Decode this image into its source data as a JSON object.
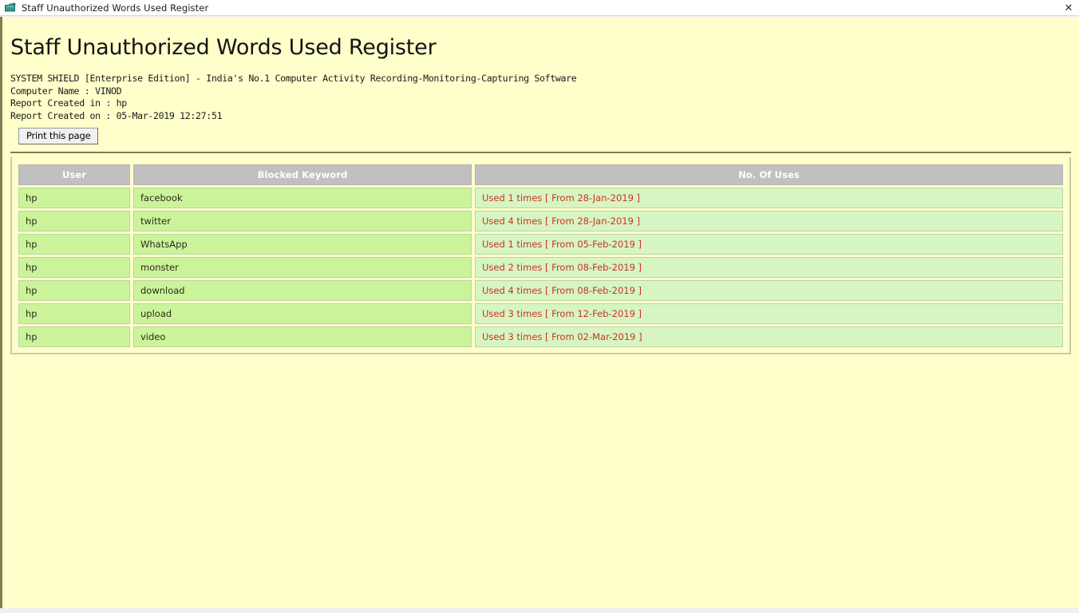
{
  "window": {
    "title": "Staff Unauthorized Words Used Register",
    "icon": "browser-window-icon",
    "close_label": "✕"
  },
  "report": {
    "heading": "Staff Unauthorized Words Used Register",
    "info_lines": [
      "SYSTEM SHIELD [Enterprise Edition] - India's No.1 Computer Activity Recording-Monitoring-Capturing Software",
      "Computer Name : VINOD",
      "Report Created in : hp",
      "Report Created on : 05-Mar-2019 12:27:51"
    ],
    "print_button_label": "Print this page"
  },
  "table": {
    "columns": [
      "User",
      "Blocked Keyword",
      "No. Of Uses"
    ],
    "rows": [
      {
        "user": "hp",
        "keyword": "facebook",
        "uses": "Used 1 times [ From 28-Jan-2019 ]"
      },
      {
        "user": "hp",
        "keyword": "twitter",
        "uses": "Used 4 times [ From 28-Jan-2019 ]"
      },
      {
        "user": "hp",
        "keyword": "WhatsApp",
        "uses": "Used 1 times [ From 05-Feb-2019 ]"
      },
      {
        "user": "hp",
        "keyword": "monster",
        "uses": "Used 2 times [ From 08-Feb-2019 ]"
      },
      {
        "user": "hp",
        "keyword": "download",
        "uses": "Used 4 times [ From 08-Feb-2019 ]"
      },
      {
        "user": "hp",
        "keyword": "upload",
        "uses": "Used 3 times [ From 12-Feb-2019 ]"
      },
      {
        "user": "hp",
        "keyword": "video",
        "uses": "Used 3 times [ From 02-Mar-2019 ]"
      }
    ]
  },
  "colors": {
    "page_background": "#ffffcc",
    "header_cell": "#c0c0c0",
    "cell_green": "#cbf49a",
    "cell_green_light": "#d6f5c3",
    "uses_text": "#cc3322",
    "rule": "#807f52"
  }
}
